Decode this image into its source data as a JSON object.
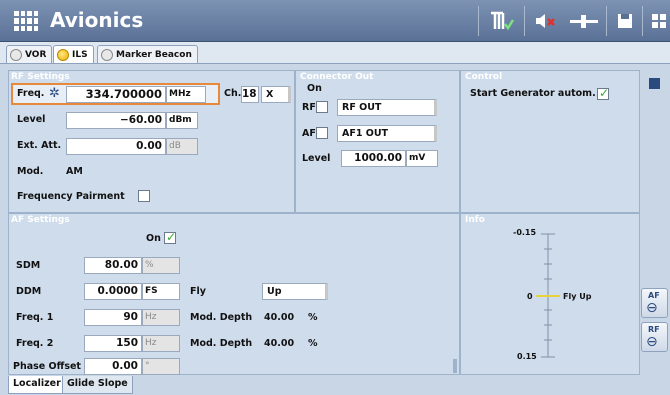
{
  "app": {
    "title": "Avionics"
  },
  "mode_tabs": [
    {
      "label": "VOR",
      "selected": false
    },
    {
      "label": "ILS",
      "selected": true
    },
    {
      "label": "Marker Beacon",
      "selected": false
    }
  ],
  "rf_settings": {
    "title": "RF Settings",
    "freq_label": "Freq.",
    "freq_value": "334.700000",
    "freq_unit": "MHz",
    "ch_label": "Ch.",
    "ch_value": "18",
    "ch_suffix": "X",
    "level_label": "Level",
    "level_value": "−60.00",
    "level_unit": "dBm",
    "ext_att_label": "Ext. Att.",
    "ext_att_value": "0.00",
    "ext_att_unit": "dB",
    "mod_label": "Mod.",
    "mod_value": "AM",
    "freq_pairment_label": "Frequency Pairment",
    "freq_pairment_checked": false
  },
  "connector_out": {
    "title": "Connector Out",
    "on_label": "On",
    "rf_label": "RF",
    "rf_checked": false,
    "rf_value": "RF OUT",
    "af_label": "AF",
    "af_checked": false,
    "af_value": "AF1 OUT",
    "level_label": "Level",
    "level_value": "1000.00",
    "level_unit": "mV"
  },
  "control": {
    "title": "Control",
    "start_label": "Start Generator autom.",
    "start_checked": true
  },
  "af_settings": {
    "title": "AF Settings",
    "on_label": "On",
    "on_checked": true,
    "sdm_label": "SDM",
    "sdm_value": "80.00",
    "sdm_unit": "%",
    "ddm_label": "DDM",
    "ddm_value": "0.0000",
    "ddm_unit": "FS",
    "fly_label": "Fly",
    "fly_value": "Up",
    "freq1_label": "Freq. 1",
    "freq1_value": "90",
    "freq1_unit": "Hz",
    "mod_depth1_label": "Mod. Depth",
    "mod_depth1_value": "40.00",
    "mod_depth1_unit": "%",
    "freq2_label": "Freq. 2",
    "freq2_value": "150",
    "freq2_unit": "Hz",
    "mod_depth2_label": "Mod. Depth",
    "mod_depth2_value": "40.00",
    "mod_depth2_unit": "%",
    "phase_label": "Phase Offset",
    "phase_value": "0.00",
    "phase_unit": "°"
  },
  "info": {
    "title": "Info",
    "top_value": "-0.15",
    "center_value": "0",
    "center_label": "Fly Up",
    "bottom_value": "0.15"
  },
  "bottom_tabs": [
    {
      "label": "Localizer",
      "selected": true
    },
    {
      "label": "Glide Slope",
      "selected": false
    }
  ],
  "side_buttons": [
    {
      "label": "AF"
    },
    {
      "label": "RF"
    }
  ],
  "colors": {
    "accent": "#e8883a",
    "panel": "#cfdcec",
    "title_bar": "#5a7196"
  }
}
